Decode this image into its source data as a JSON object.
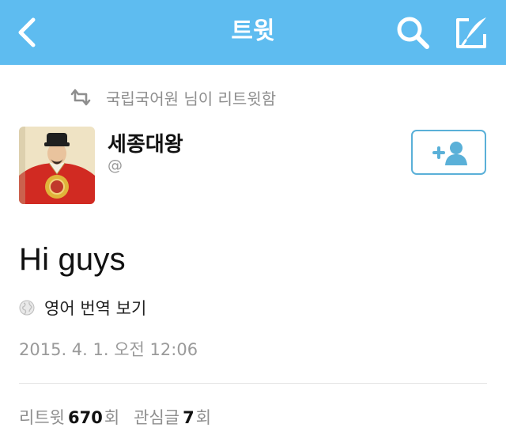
{
  "header": {
    "title": "트윗",
    "back_icon": "chevron-left-icon",
    "search_icon": "search-icon",
    "compose_icon": "compose-icon",
    "bar_color": "#5ebcf0"
  },
  "retweet_notice": {
    "icon": "retweet-icon",
    "text": "국립국어원 님이 리트윗함"
  },
  "user": {
    "name": "세종대왕",
    "handle": "@",
    "avatar": "avatar-portrait",
    "follow_icon": "add-user-icon"
  },
  "tweet": {
    "text": "Hi guys",
    "translate_icon": "globe-icon",
    "translate_label": "영어 번역 보기",
    "timestamp": "2015. 4. 1. 오전 12:06"
  },
  "stats": {
    "retweets_label": "리트윗",
    "retweets_count": "670",
    "retweets_suffix": "회",
    "favorites_label": "관심글",
    "favorites_count": "7",
    "favorites_suffix": "회"
  }
}
